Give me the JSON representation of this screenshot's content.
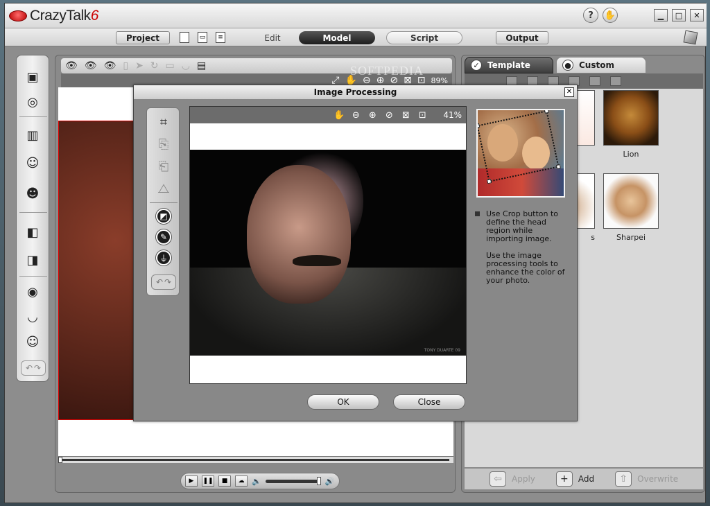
{
  "app": {
    "brand": "CrazyTalk",
    "brand_version": "6",
    "help_glyph": "?",
    "hand_glyph": "✋"
  },
  "window_controls": {
    "minimize": "▁",
    "maximize": "□",
    "close": "✕"
  },
  "menu": {
    "project": "Project",
    "edit": "Edit",
    "model": "Model",
    "script": "Script",
    "output": "Output"
  },
  "viewport": {
    "zoom": "89%"
  },
  "watermark": "SOFTPEDIA",
  "right_panel": {
    "tabs": {
      "template": "Template",
      "custom": "Custom"
    },
    "items": [
      {
        "label": "Lion",
        "icon": "lion-thumbnail"
      },
      {
        "label": "Sharpei",
        "icon": "sharpei-thumbnail"
      },
      {
        "label": "s",
        "icon": "partial-thumbnail"
      }
    ],
    "actions": {
      "apply": "Apply",
      "add": "Add",
      "overwrite": "Overwrite"
    }
  },
  "dialog": {
    "title": "Image Processing",
    "zoom": "41%",
    "help_1": "Use Crop button to define the head region while importing image.",
    "help_2": "Use the image processing tools to enhance the color of your photo.",
    "ok": "OK",
    "close": "Close",
    "signature": "TONY DUARTE 09"
  }
}
